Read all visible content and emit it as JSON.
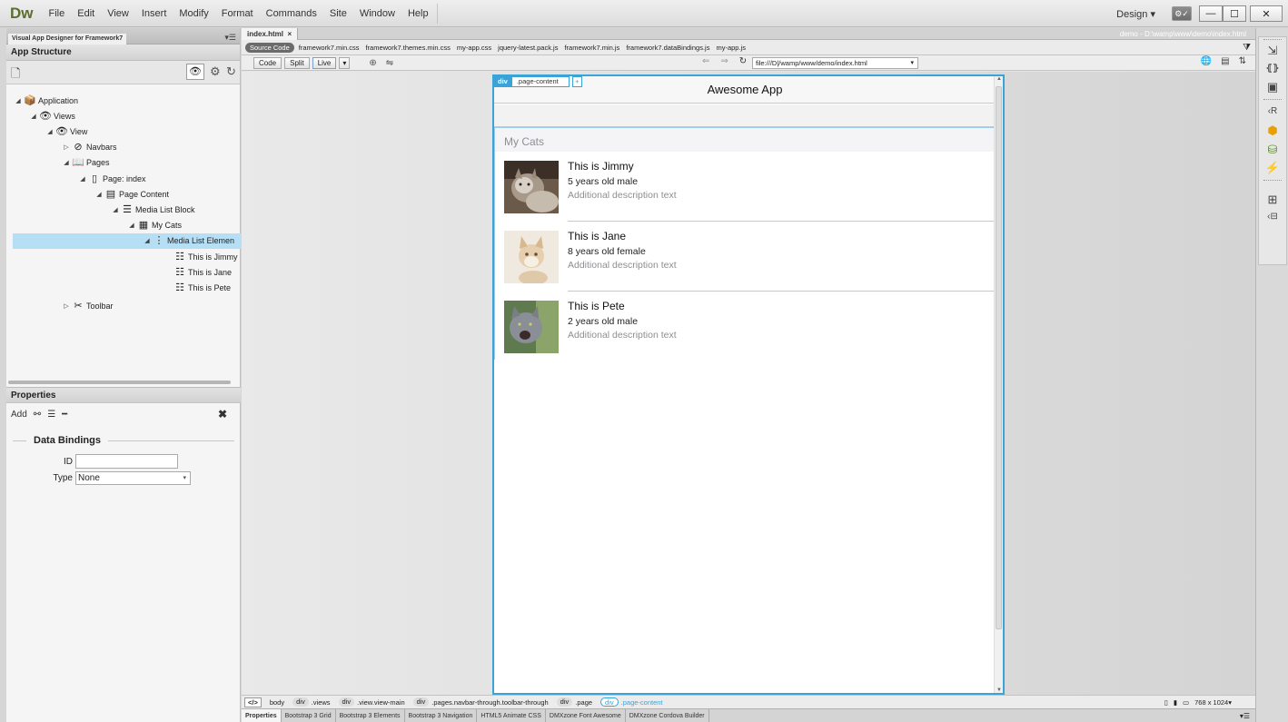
{
  "menubar": {
    "logo": "Dw",
    "items": [
      "File",
      "Edit",
      "View",
      "Insert",
      "Modify",
      "Format",
      "Commands",
      "Site",
      "Window",
      "Help"
    ],
    "workspace": "Design",
    "workspace_caret": "▾",
    "min_glyph": "—",
    "max_glyph": "☐",
    "close_glyph": "✕",
    "gear_glyph": "⚙✓"
  },
  "left_panel": {
    "tab": "Visual App Designer for Framework7",
    "tab_menu": "▾☰",
    "title": "App Structure",
    "toolbar_glyphs": {
      "new": "🗋",
      "eye": "👁",
      "gear": "⚙",
      "refresh": "↻"
    },
    "tree": [
      {
        "label": "Application",
        "icon": "package-icon",
        "glyph": "📦",
        "arrow": "◢"
      },
      {
        "label": "Views",
        "icon": "eye-icon",
        "glyph": "👁",
        "arrow": "◢"
      },
      {
        "label": "View",
        "icon": "eye-icon",
        "glyph": "👁",
        "arrow": "◢"
      },
      {
        "label": "Navbars",
        "icon": "compass-icon",
        "glyph": "⊘",
        "arrow": "▷"
      },
      {
        "label": "Pages",
        "icon": "book-icon",
        "glyph": "📖",
        "arrow": "◢"
      },
      {
        "label": "Page: index",
        "icon": "page-icon",
        "glyph": "▯",
        "arrow": "◢"
      },
      {
        "label": "Page Content",
        "icon": "page-content-icon",
        "glyph": "▤",
        "arrow": "◢"
      },
      {
        "label": "Media List Block",
        "icon": "list-icon",
        "glyph": "☰",
        "arrow": "◢"
      },
      {
        "label": "My Cats",
        "icon": "block-icon",
        "glyph": "▦",
        "arrow": "◢"
      },
      {
        "label": "Media List Elemen",
        "icon": "vertical-dots-icon",
        "glyph": "⋮",
        "arrow": "◢"
      },
      {
        "label": "This is Jimmy",
        "icon": "list-item-icon",
        "glyph": "☷",
        "arrow": ""
      },
      {
        "label": "This is Jane",
        "icon": "list-item-icon",
        "glyph": "☷",
        "arrow": ""
      },
      {
        "label": "This is Pete",
        "icon": "list-item-icon",
        "glyph": "☷",
        "arrow": ""
      },
      {
        "label": "Toolbar",
        "icon": "tools-icon",
        "glyph": "✂",
        "arrow": "▷"
      }
    ],
    "properties": {
      "title": "Properties",
      "add_label": "Add",
      "add_glyphs": {
        "link": "⚯",
        "list": "☰",
        "remove": "━",
        "close": "✖"
      },
      "section": "Data Bindings",
      "id_label": "ID",
      "id_value": "",
      "type_label": "Type",
      "type_value": "None",
      "select_caret": "▾"
    }
  },
  "document": {
    "tab": "index.html",
    "tab_close": "×",
    "path": "demo - D:\\wamp\\www\\demo\\index.html",
    "source_code": "Source Code",
    "related_files": [
      "framework7.min.css",
      "framework7.themes.min.css",
      "my-app.css",
      "jquery-latest.pack.js",
      "framework7.min.js",
      "framework7.dataBindings.js",
      "my-app.js"
    ],
    "filter_glyph": "⧩",
    "view_buttons": {
      "code": "Code",
      "split": "Split",
      "live": "Live",
      "live_caret": "▾"
    },
    "tool_glyphs": {
      "inspect": "⊕",
      "sync": "⇋"
    },
    "nav_glyphs": {
      "back": "⇐",
      "forward": "⇒",
      "refresh": "↻"
    },
    "url": "file:///D|/wamp/www/demo/index.html",
    "url_caret": "▾",
    "right_tool_glyphs": {
      "globe": "🌐",
      "page_check": "▤",
      "sort": "⇅"
    },
    "element_tag": {
      "tag": "div",
      "class": ".page-content",
      "add": "+"
    },
    "scroll_glyphs": {
      "up": "▲",
      "down": "▼"
    }
  },
  "app_preview": {
    "navbar_title": "Awesome App",
    "block_title": "My Cats",
    "items": [
      {
        "title": "This is Jimmy",
        "subtitle": "5 years old male",
        "text": "Additional description text"
      },
      {
        "title": "This is Jane",
        "subtitle": "8 years old female",
        "text": "Additional description text"
      },
      {
        "title": "This is Pete",
        "subtitle": "2 years old male",
        "text": "Additional description text"
      }
    ]
  },
  "tag_selector": {
    "code": "</>",
    "tags": [
      {
        "tag": "body",
        "cls": ""
      },
      {
        "tag": "div",
        "cls": ".views"
      },
      {
        "tag": "div",
        "cls": ".view.view-main"
      },
      {
        "tag": "div",
        "cls": ".pages.navbar-through.toolbar-through"
      },
      {
        "tag": "div",
        "cls": ".page"
      },
      {
        "tag": "div",
        "cls": ".page-content"
      }
    ],
    "size": "768 x 1024",
    "size_caret": "▾",
    "device_glyphs": {
      "phone": "▯",
      "tablet": "▮",
      "desktop": "▭"
    }
  },
  "panel_tabs": [
    "Properties",
    "Bootstrap 3 Grid",
    "Bootstrap 3 Elements",
    "Bootstrap 3 Navigation",
    "HTML5 Animate CSS",
    "DMXzone Font Awesome",
    "DMXzone Cordova Builder"
  ],
  "panel_tabs_end": "▾☰",
  "right_strip": {
    "icons": [
      {
        "name": "insert-panel-icon",
        "glyph": "⇲"
      },
      {
        "name": "css-designer-icon",
        "glyph": "⦃⦄"
      },
      {
        "name": "assets-icon",
        "glyph": "▣"
      },
      {
        "name": "snippets-icon",
        "glyph": "‹R"
      },
      {
        "name": "bootstrap-icon",
        "glyph": "⬢"
      },
      {
        "name": "database-icon",
        "glyph": "⛁"
      },
      {
        "name": "behaviors-icon",
        "glyph": "⚡"
      },
      {
        "name": "files-icon",
        "glyph": "⊞"
      },
      {
        "name": "dom-icon",
        "glyph": "‹⊟"
      }
    ]
  }
}
